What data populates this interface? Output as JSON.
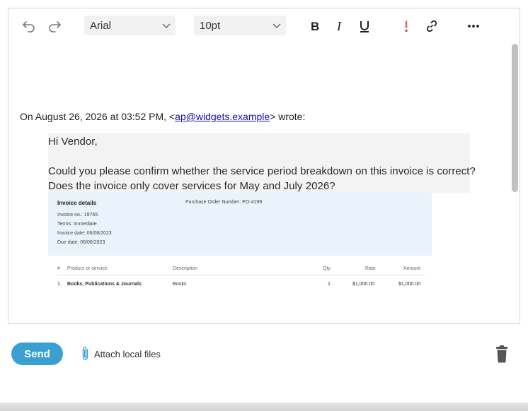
{
  "toolbar": {
    "font_family": "Arial",
    "font_size": "10pt",
    "icons": [
      "undo-icon",
      "redo-icon",
      "bold-icon",
      "italic-icon",
      "underline-icon",
      "important-icon",
      "link-icon",
      "more-icon"
    ]
  },
  "reply": {
    "quote_header_prefix": "On August 26, 2026 at 03:52 PM, <",
    "quote_email": "ap@widgets.example",
    "quote_header_suffix": "> wrote:",
    "greeting": "Hi Vendor,",
    "body_line1": "Could you please confirm whether the service period breakdown on this invoice is correct?",
    "body_line2": "Does the invoice only cover services for May and July 2026?"
  },
  "invoice": {
    "title": "Invoice details",
    "po": "Purchase Order Number: PO-4199",
    "number": "Invoice no.: 19765",
    "terms": "Terms: Immediate",
    "date": "Invoice date: 06/08/2023",
    "due": "Due date: 06/08/2023",
    "headers": {
      "num": "#",
      "product": "Product or service",
      "description": "Description",
      "qty": "Qty",
      "rate": "Rate",
      "amount": "Amount"
    },
    "row": {
      "num": "1.",
      "product": "Books, Publications & Journals",
      "description": "Books",
      "qty": "1",
      "rate": "$1,000.00",
      "amount": "$1,000.00"
    }
  },
  "footer": {
    "send_label": "Send",
    "attach_label": "Attach local files"
  },
  "colors": {
    "send": "#3aa0d2",
    "important": "#e04545",
    "link": "#1a0dab",
    "quote_bg": "#f3f3f3",
    "invoice_bg": "#eaf2fb"
  }
}
